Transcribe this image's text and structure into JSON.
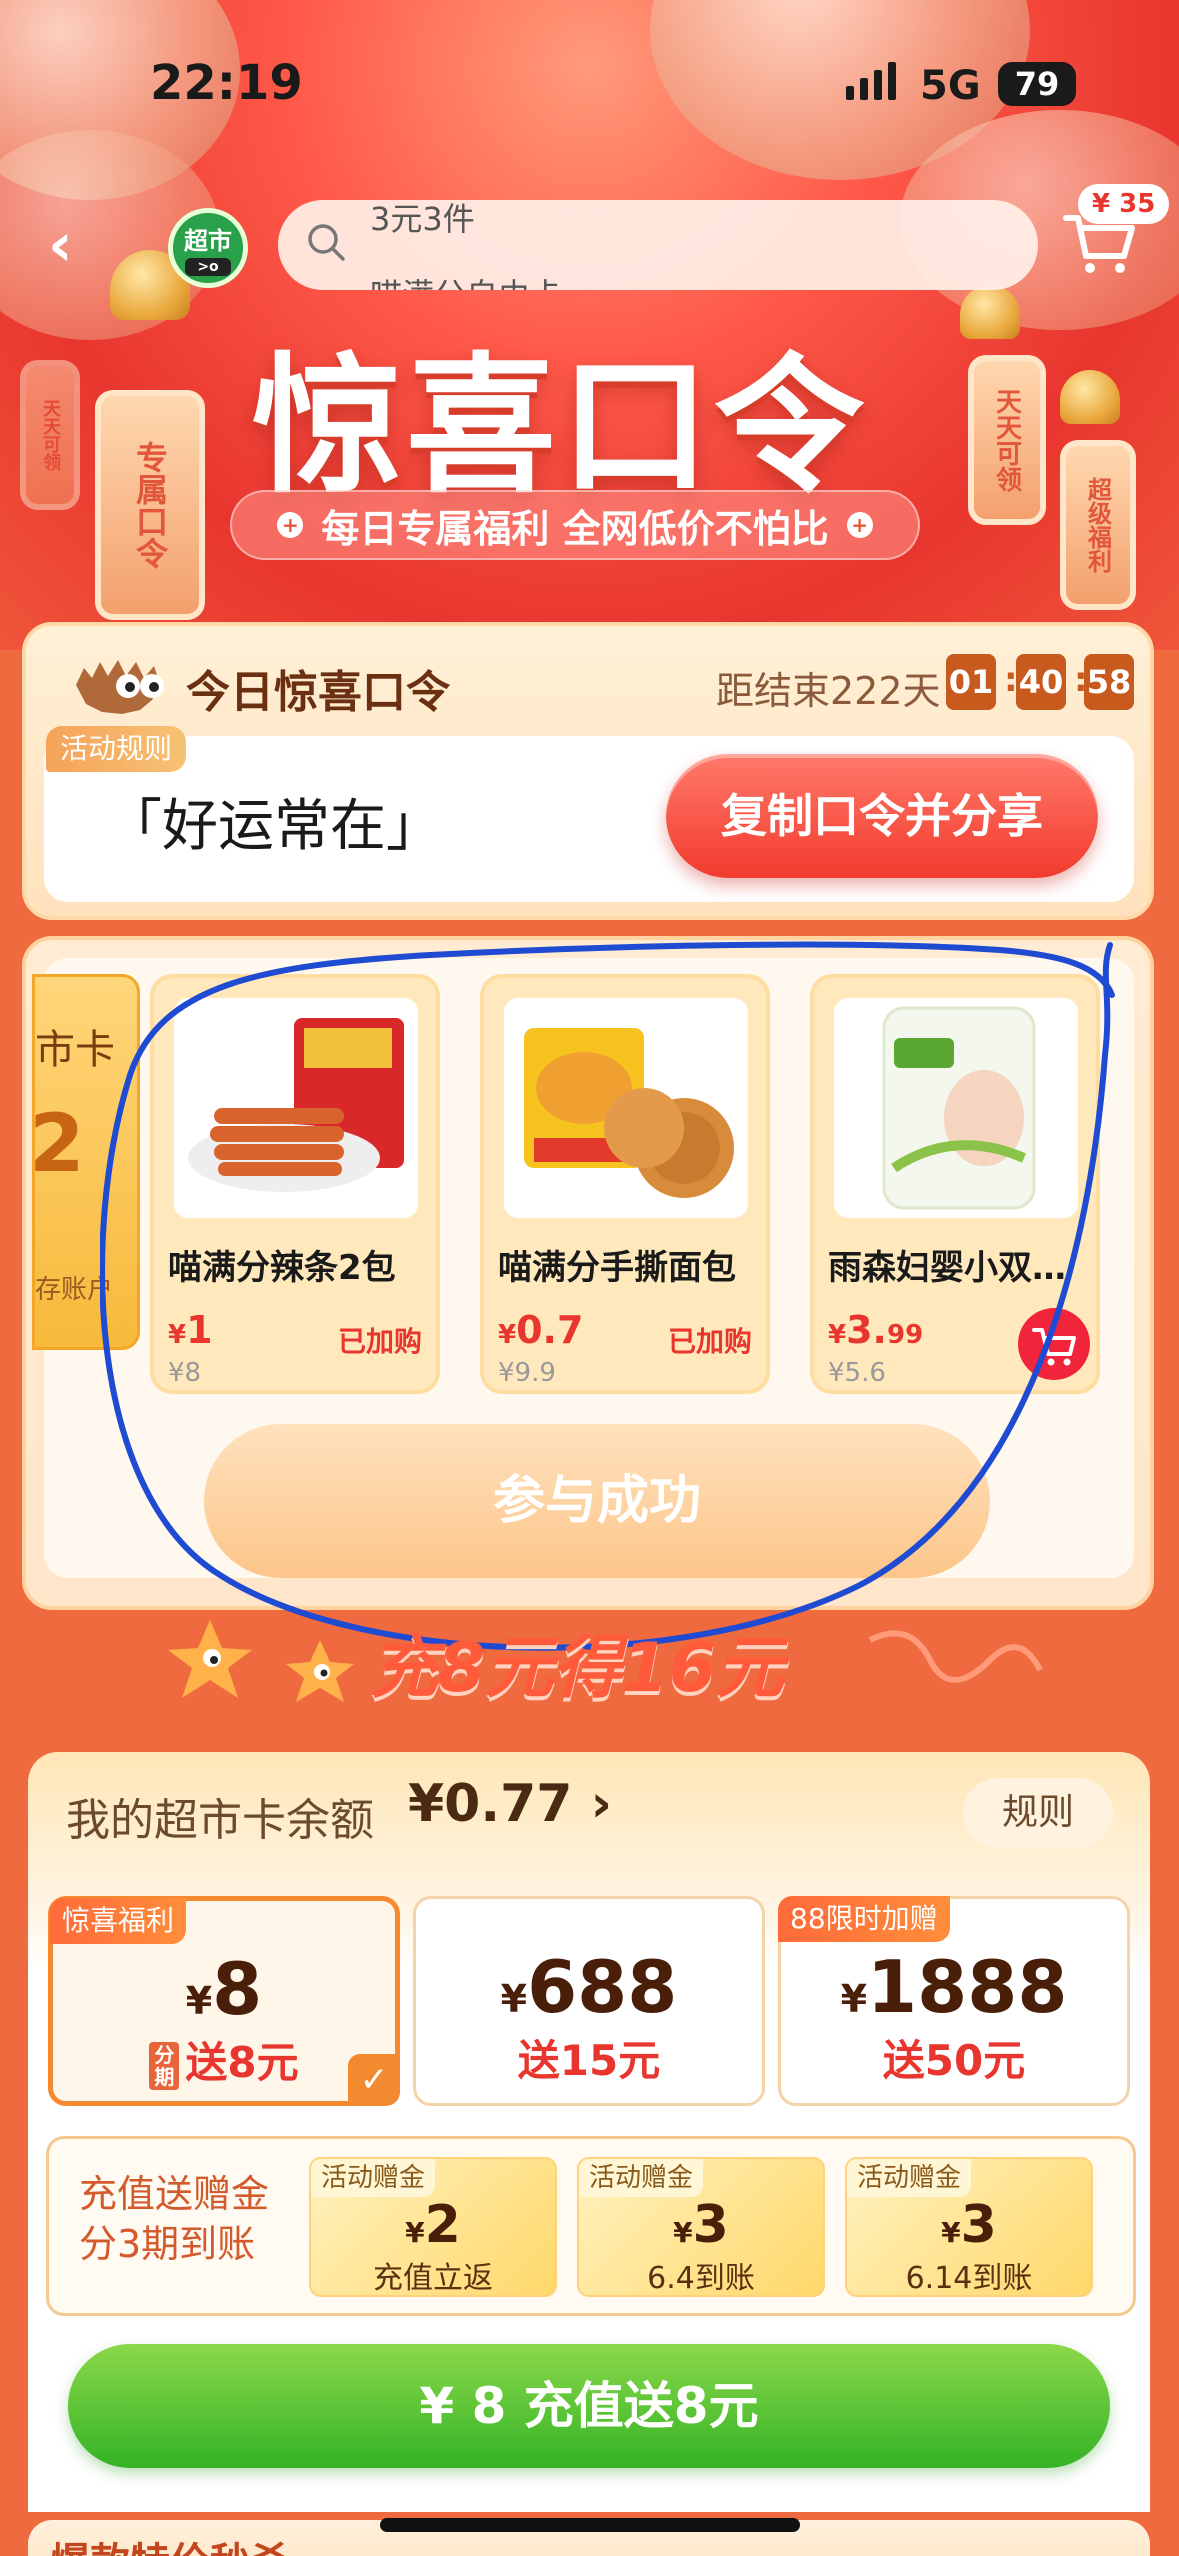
{
  "status_bar": {
    "time": "22:19",
    "network": "5G",
    "battery": "79"
  },
  "header": {
    "logo_label": "超市",
    "logo_face": "&gt;o",
    "search_line1": "3元3件",
    "search_line2": "喵满分自由卡",
    "cart_badge": "¥ 35"
  },
  "hero": {
    "title": "惊喜口令",
    "subtitle": "每日专属福利 全网低价不怕比",
    "tags": [
      "专属口令",
      "天天可领",
      "超级福利",
      "天天可领"
    ]
  },
  "daily_code": {
    "title": "今日惊喜口令",
    "countdown_label": "距结束222天",
    "countdown": [
      "01",
      "40",
      "58"
    ],
    "rules_tag": "活动规则",
    "code": "「好运常在」",
    "share_button": "复制口令并分享"
  },
  "products_section": {
    "side_card": {
      "line1": "市卡",
      "line2": "2",
      "line3": "存账户"
    },
    "products": [
      {
        "name": "喵满分辣条2包",
        "price_symbol": "¥",
        "price": "1",
        "original": "¥8",
        "status": "已加购"
      },
      {
        "name": "喵满分手撕面包",
        "price_symbol": "¥",
        "price": "0.7",
        "original": "¥9.9",
        "status": "已加购"
      },
      {
        "name": "雨森妇婴小双…",
        "price_symbol": "¥",
        "price": "3.",
        "price_small": "99",
        "original": "¥5.6",
        "status": ""
      }
    ],
    "join_button": "参与成功"
  },
  "banner": {
    "text": "充8元得16元"
  },
  "recharge": {
    "balance_label": "我的超市卡余额",
    "balance_value": "¥0.77 ›",
    "rules_button": "规则",
    "options": [
      {
        "badge": "惊喜福利",
        "amount": "8",
        "gift": "送8元",
        "installment": "分期",
        "selected": true
      },
      {
        "badge": "",
        "amount": "688",
        "gift": "送15元",
        "selected": false
      },
      {
        "badge": "88限时加赠",
        "amount": "1888",
        "gift": "送50元",
        "selected": false
      }
    ],
    "gift_label": "充值送赠金\n分3期到账",
    "gifts": [
      {
        "tag": "活动赠金",
        "amount": "2",
        "when": "充值立返"
      },
      {
        "tag": "活动赠金",
        "amount": "3",
        "when": "6.4到账"
      },
      {
        "tag": "活动赠金",
        "amount": "3",
        "when": "6.14到账"
      }
    ],
    "pay_button": "¥ 8 充值送8元"
  },
  "bottom_peek": "爆款特价秒杀",
  "colors": {
    "accent_red": "#e8362e",
    "pay_green": "#34b326",
    "orange": "#f38a30"
  }
}
